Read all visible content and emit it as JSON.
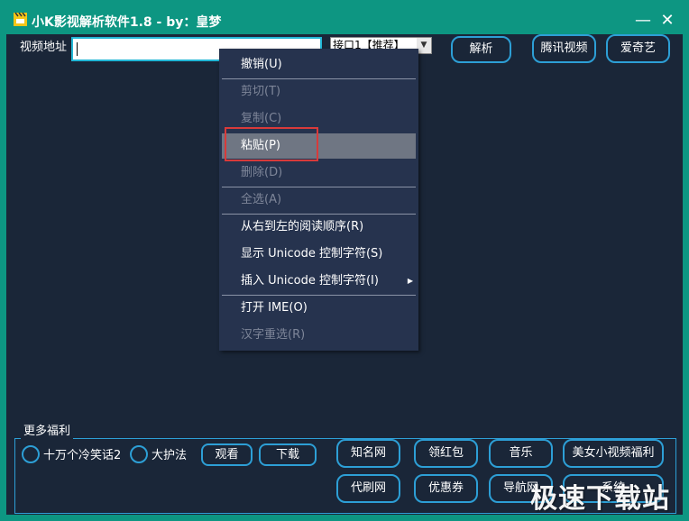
{
  "window": {
    "title": "小K影视解析软件1.8 - by：皇梦",
    "minimize_glyph": "—",
    "close_glyph": "✕",
    "frame_color": "#0d9682",
    "client_color": "#1a2638"
  },
  "toolbar": {
    "url_label": "视频地址",
    "url_value": "",
    "api_selected": "接口1【推荐】",
    "parse_label": "解析",
    "tencent_label": "腾讯视频",
    "iqiyi_label": "爱奇艺"
  },
  "context_menu": {
    "items": [
      {
        "label": "撤销(U)",
        "enabled": true
      },
      {
        "label": "剪切(T)",
        "enabled": false
      },
      {
        "label": "复制(C)",
        "enabled": false
      },
      {
        "label": "粘贴(P)",
        "enabled": true,
        "highlighted": true
      },
      {
        "label": "删除(D)",
        "enabled": false
      },
      {
        "label": "全选(A)",
        "enabled": false
      },
      {
        "label": "从右到左的阅读顺序(R)",
        "enabled": true
      },
      {
        "label": "显示 Unicode 控制字符(S)",
        "enabled": true
      },
      {
        "label": "插入 Unicode 控制字符(I)",
        "enabled": true,
        "submenu": true
      },
      {
        "label": "打开 IME(O)",
        "enabled": true
      },
      {
        "label": "汉字重选(R)",
        "enabled": false
      }
    ]
  },
  "bonus": {
    "group_title": "更多福利",
    "option1": "十万个冷笑话2",
    "option2": "大护法",
    "watch_label": "观看",
    "download_label": "下载",
    "links_row1": [
      "知名网",
      "领红包",
      "音乐",
      "美女小视频福利"
    ],
    "links_row2": [
      "代刷网",
      "优惠券",
      "导航网",
      "系统"
    ]
  },
  "watermark": "极速下载站",
  "colors": {
    "accent": "#2d9fd6",
    "menu_bg": "#26334e",
    "menu_highlight": "#6f7683",
    "red_box": "#d83a3a"
  }
}
